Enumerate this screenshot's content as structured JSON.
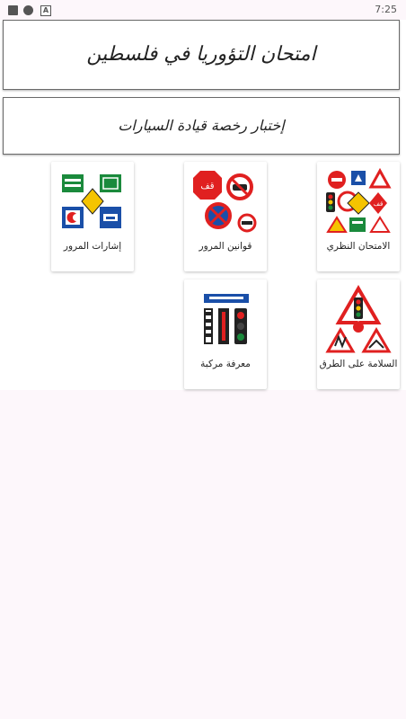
{
  "status_bar": {
    "time": "7:25"
  },
  "header": {
    "title": "امتحان التؤوريا في فلسطين",
    "subtitle": "إختبار رخصة قيادة السيارات"
  },
  "grid": {
    "items": [
      {
        "label": "الامتحان النظري",
        "icon": "mixed-road-signs-icon"
      },
      {
        "label": "قوانين المرور",
        "icon": "stop-and-prohibition-signs-icon"
      },
      {
        "label": "إشارات المرور",
        "icon": "guidance-signs-icon"
      },
      {
        "label": "السلامة على الطرق",
        "icon": "warning-triangle-signs-icon"
      },
      {
        "label": "معرفة مركبة",
        "icon": "traffic-lights-icon"
      }
    ]
  },
  "colors": {
    "background": "#fdf7fb",
    "panel": "#ffffff",
    "sign_red": "#e02020",
    "sign_blue": "#1a4fa8",
    "sign_green": "#1a8a3c",
    "sign_yellow": "#f5c400"
  }
}
